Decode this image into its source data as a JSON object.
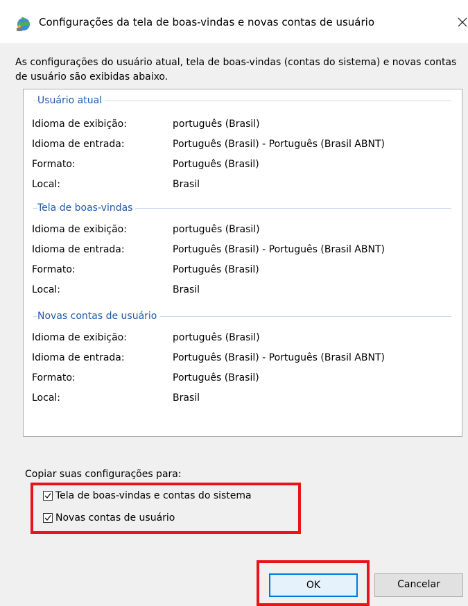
{
  "window": {
    "title": "Configurações da tela de boas-vindas e novas contas de usuário"
  },
  "description": "As configurações do usuário atual, tela de boas-vindas (contas do sistema) e novas contas de usuário são exibidas abaixo.",
  "labels": {
    "display_language": "Idioma de exibição:",
    "input_language": "Idioma de entrada:",
    "format": "Formato:",
    "location": "Local:"
  },
  "sections": [
    {
      "title": "Usuário atual",
      "display_language": "português (Brasil)",
      "input_language": "Português (Brasil) - Português (Brasil ABNT)",
      "format": "Português (Brasil)",
      "location": "Brasil"
    },
    {
      "title": "Tela de boas-vindas",
      "display_language": "português (Brasil)",
      "input_language": "Português (Brasil) - Português (Brasil ABNT)",
      "format": "Português (Brasil)",
      "location": "Brasil"
    },
    {
      "title": "Novas contas de usuário",
      "display_language": "português (Brasil)",
      "input_language": "Português (Brasil) - Português (Brasil ABNT)",
      "format": "Português (Brasil)",
      "location": "Brasil"
    }
  ],
  "copy": {
    "label": "Copiar suas configurações para:",
    "options": [
      {
        "label": "Tela de boas-vindas e contas do sistema",
        "checked": true
      },
      {
        "label": "Novas contas de usuário",
        "checked": true
      }
    ]
  },
  "buttons": {
    "ok": "OK",
    "cancel": "Cancelar"
  },
  "colors": {
    "section_title": "#1e5aa8",
    "highlight": "#e8141b",
    "ok_border": "#0078d7"
  },
  "icons": {
    "title_icon": "globe-icon",
    "close_icon": "close-icon"
  }
}
